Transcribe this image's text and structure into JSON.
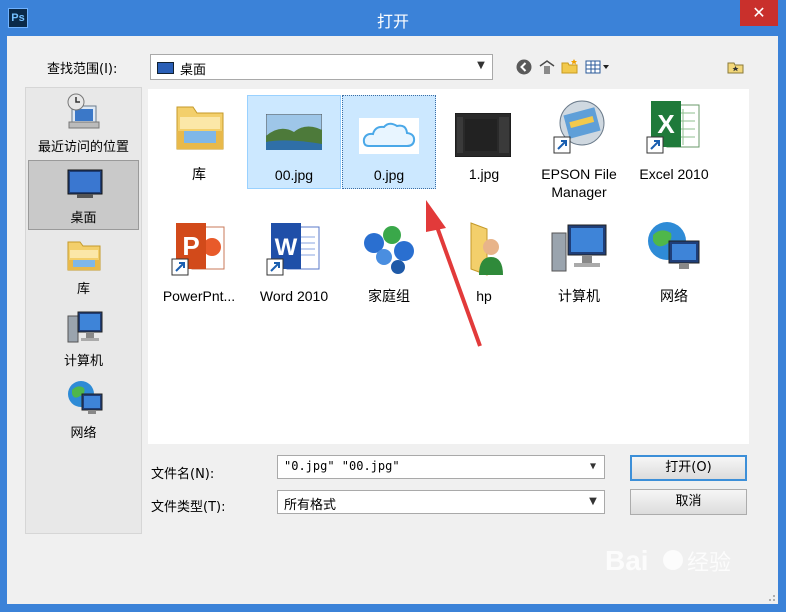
{
  "window": {
    "title": "打开",
    "app_icon_text": "Ps",
    "close_glyph": "✕"
  },
  "lookin": {
    "label": "查找范围(I):",
    "value": "桌面"
  },
  "places": [
    {
      "label": "最近访问的位置",
      "icon": "recent-places-icon",
      "selected": false
    },
    {
      "label": "桌面",
      "icon": "desktop-icon",
      "selected": true
    },
    {
      "label": "库",
      "icon": "library-icon",
      "selected": false
    },
    {
      "label": "计算机",
      "icon": "computer-icon",
      "selected": false
    },
    {
      "label": "网络",
      "icon": "network-icon",
      "selected": false
    }
  ],
  "files": [
    {
      "label": "库",
      "icon": "library-folder-icon"
    },
    {
      "label": "00.jpg",
      "icon": "landscape-image-icon",
      "state": "selected"
    },
    {
      "label": "0.jpg",
      "icon": "cloud-image-icon",
      "state": "focused"
    },
    {
      "label": "1.jpg",
      "icon": "dark-image-icon"
    },
    {
      "label": "EPSON File",
      "label2": "Manager",
      "icon": "epson-icon"
    },
    {
      "label": "Excel 2010",
      "icon": "excel-icon"
    },
    {
      "label": "PowerPnt...",
      "icon": "powerpoint-icon"
    },
    {
      "label": "Word 2010",
      "icon": "word-icon"
    },
    {
      "label": "家庭组",
      "icon": "homegroup-icon"
    },
    {
      "label": "hp",
      "icon": "user-folder-icon"
    },
    {
      "label": "计算机",
      "icon": "computer-icon"
    },
    {
      "label": "网络",
      "icon": "network-icon"
    }
  ],
  "filename": {
    "label": "文件名(N):",
    "value": "\"0.jpg\" \"00.jpg\""
  },
  "filetype": {
    "label": "文件类型(T):",
    "value": "所有格式"
  },
  "buttons": {
    "open": "打开(O)",
    "cancel": "取消"
  },
  "colors": {
    "title_bar": "#3b82d8",
    "close_button": "#c9302c",
    "selection": "#cce8ff",
    "annotation_arrow": "#e23a3a"
  }
}
